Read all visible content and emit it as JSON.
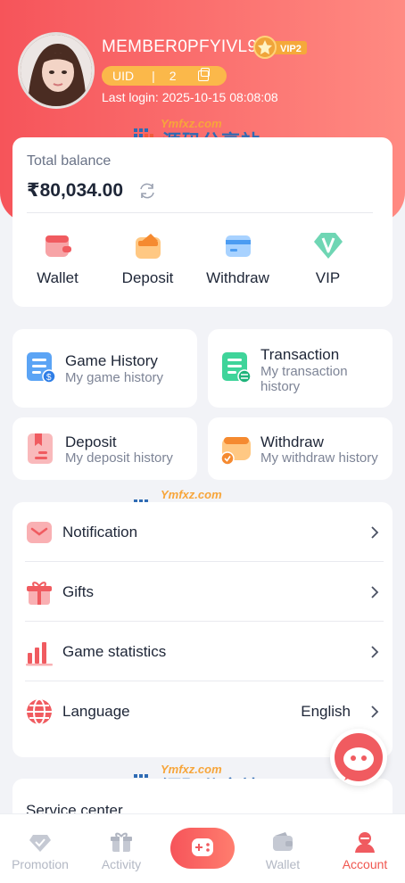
{
  "profile": {
    "member_name": "MEMBER0PFYIVL9",
    "vip_level": "VIP2",
    "uid_label": "UID",
    "uid_separator": "|",
    "uid_value": "2",
    "last_login": "Last login: 2025-10-15 08:08:08"
  },
  "balance": {
    "label": "Total balance",
    "amount": "₹80,034.00"
  },
  "quick_actions": [
    {
      "label": "Wallet",
      "icon": "wallet-icon"
    },
    {
      "label": "Deposit",
      "icon": "deposit-icon"
    },
    {
      "label": "Withdraw",
      "icon": "withdraw-icon"
    },
    {
      "label": "VIP",
      "icon": "vip-icon"
    }
  ],
  "history_cards": {
    "game": {
      "title": "Game History",
      "sub": "My game history"
    },
    "transaction": {
      "title": "Transaction",
      "sub": "My transaction history"
    },
    "deposit": {
      "title": "Deposit",
      "sub": "My deposit history"
    },
    "withdraw": {
      "title": "Withdraw",
      "sub": "My withdraw history"
    }
  },
  "menu": {
    "notification": "Notification",
    "gifts": "Gifts",
    "game_statistics": "Game statistics",
    "language": "Language",
    "language_value": "English"
  },
  "service": {
    "title": "Service center"
  },
  "watermark": {
    "domain": "Ymfxz.com",
    "domain_tag": "官网",
    "main": "源码分享站"
  },
  "tabbar": [
    {
      "label": "Promotion",
      "icon": "diamond-icon"
    },
    {
      "label": "Activity",
      "icon": "gift-icon"
    },
    {
      "label": "",
      "icon": "gamepad-icon"
    },
    {
      "label": "Wallet",
      "icon": "wallet-icon"
    },
    {
      "label": "Account",
      "icon": "account-icon"
    }
  ],
  "colors": {
    "primary": "#f6545a",
    "accent_orange": "#fbb84a",
    "text_dark": "#1e2637",
    "text_muted": "#7d8496"
  }
}
